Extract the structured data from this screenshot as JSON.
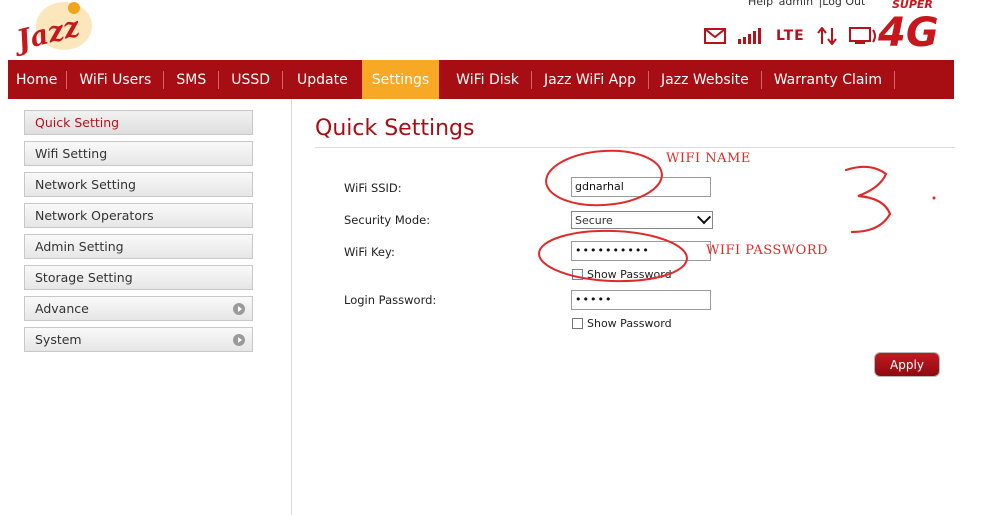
{
  "brand": {
    "logo_text": "Jazz",
    "badge_top": "SUPER",
    "badge_main": "4G"
  },
  "top_links": {
    "help": "Help",
    "user": "admin",
    "logout": "|Log Out"
  },
  "status": {
    "network": "LTE"
  },
  "nav": {
    "items": [
      {
        "label": "Home"
      },
      {
        "label": "WiFi Users"
      },
      {
        "label": "SMS"
      },
      {
        "label": "USSD"
      },
      {
        "label": "Update"
      },
      {
        "label": "Settings"
      },
      {
        "label": "WiFi Disk"
      },
      {
        "label": "Jazz WiFi App"
      },
      {
        "label": "Jazz Website"
      },
      {
        "label": "Warranty Claim"
      }
    ],
    "active": "Settings"
  },
  "sidebar": {
    "items": [
      {
        "label": "Quick Setting"
      },
      {
        "label": "Wifi Setting"
      },
      {
        "label": "Network Setting"
      },
      {
        "label": "Network Operators"
      },
      {
        "label": "Admin Setting"
      },
      {
        "label": "Storage Setting"
      },
      {
        "label": "Advance"
      },
      {
        "label": "System"
      }
    ]
  },
  "main": {
    "title": "Quick Settings",
    "ssid_label": "WiFi SSID:",
    "ssid_value": "gdnarhal",
    "security_label": "Security Mode:",
    "security_value": "Secure",
    "wifikey_label": "WiFi Key:",
    "wifikey_value": "••••••••••",
    "login_label": "Login Password:",
    "login_value": "•••••",
    "show_password": "Show Password",
    "apply": "Apply"
  },
  "annotations": {
    "wifi_name": "WIFI NAME",
    "wifi_password": "WIFI PASSWORD"
  },
  "colors": {
    "brand_red": "#a70e13",
    "active_tab": "#f7a825",
    "annotation": "#e02a2a"
  }
}
